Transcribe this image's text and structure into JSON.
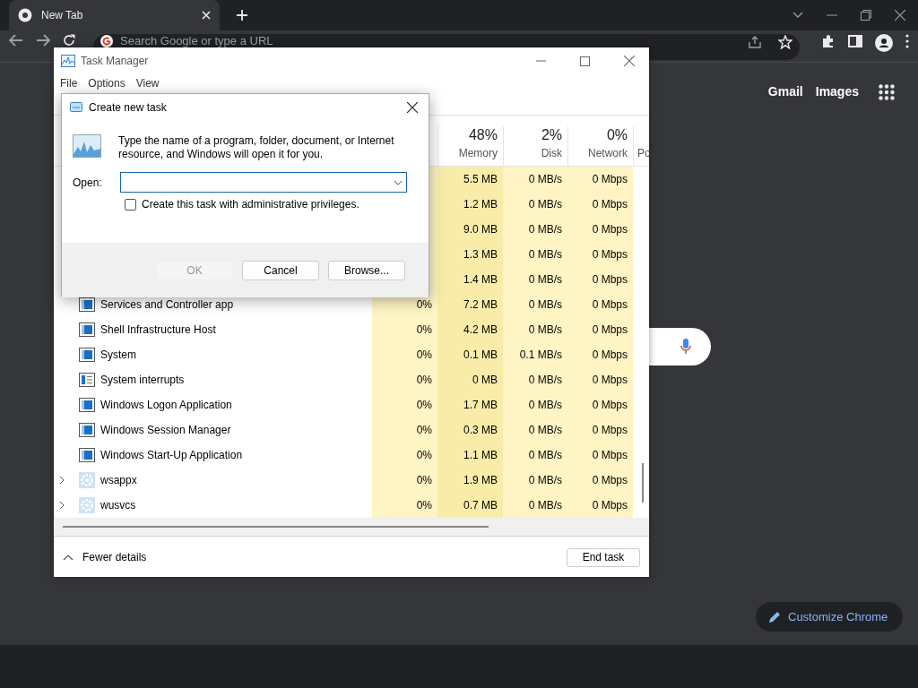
{
  "browser": {
    "tabs": [
      {
        "label": "New Tab",
        "selected": true
      }
    ],
    "omnibox": {
      "placeholder": "Search Google or type a URL"
    },
    "header_links": [
      "Gmail",
      "Images"
    ],
    "customize_button": "Customize Chrome"
  },
  "task_manager": {
    "title": "Task Manager",
    "menu": [
      "File",
      "Options",
      "View"
    ],
    "columns": [
      {
        "percent": "48%",
        "label": "Memory"
      },
      {
        "percent": "2%",
        "label": "Disk"
      },
      {
        "percent": "0%",
        "label": "Network"
      },
      {
        "label": "Po"
      }
    ],
    "rows": [
      {
        "memory": "5.5 MB",
        "disk": "0 MB/s",
        "network": "0 Mbps"
      },
      {
        "memory": "1.2 MB",
        "disk": "0 MB/s",
        "network": "0 Mbps"
      },
      {
        "memory": "9.0 MB",
        "disk": "0 MB/s",
        "network": "0 Mbps"
      },
      {
        "memory": "1.3 MB",
        "disk": "0 MB/s",
        "network": "0 Mbps"
      },
      {
        "memory": "1.4 MB",
        "disk": "0 MB/s",
        "network": "0 Mbps"
      },
      {
        "kind": "process",
        "name": "Services and Controller app",
        "cpu": "0%",
        "memory": "7.2 MB",
        "disk": "0 MB/s",
        "network": "0 Mbps"
      },
      {
        "kind": "process",
        "name": "Shell Infrastructure Host",
        "cpu": "0%",
        "memory": "4.2 MB",
        "disk": "0 MB/s",
        "network": "0 Mbps"
      },
      {
        "kind": "process",
        "name": "System",
        "cpu": "0%",
        "memory": "0.1 MB",
        "disk": "0.1 MB/s",
        "network": "0 Mbps"
      },
      {
        "kind": "interrupts",
        "name": "System interrupts",
        "cpu": "0%",
        "memory": "0 MB",
        "disk": "0 MB/s",
        "network": "0 Mbps"
      },
      {
        "kind": "process",
        "name": "Windows Logon Application",
        "cpu": "0%",
        "memory": "1.7 MB",
        "disk": "0 MB/s",
        "network": "0 Mbps"
      },
      {
        "kind": "process",
        "name": "Windows Session Manager",
        "cpu": "0%",
        "memory": "0.3 MB",
        "disk": "0 MB/s",
        "network": "0 Mbps"
      },
      {
        "kind": "process",
        "name": "Windows Start-Up Application",
        "cpu": "0%",
        "memory": "1.1 MB",
        "disk": "0 MB/s",
        "network": "0 Mbps"
      },
      {
        "kind": "service",
        "name": "wsappx",
        "expanded": false,
        "cpu": "0%",
        "memory": "1.9 MB",
        "disk": "0 MB/s",
        "network": "0 Mbps"
      },
      {
        "kind": "service",
        "name": "wusvcs",
        "expanded": false,
        "cpu": "0%",
        "memory": "0.7 MB",
        "disk": "0 MB/s",
        "network": "0 Mbps"
      }
    ],
    "footer": {
      "toggle": "Fewer details",
      "end_task": "End task"
    }
  },
  "dialog": {
    "title": "Create new task",
    "message": "Type the name of a program, folder, document, or Internet resource, and Windows will open it for you.",
    "open_label": "Open:",
    "admin": {
      "label": "Create this task with administrative privileges.",
      "checked": false
    },
    "buttons": [
      {
        "label": "OK",
        "disabled": true
      },
      {
        "label": "Cancel",
        "disabled": false
      },
      {
        "label": "Browse...",
        "disabled": false
      }
    ]
  }
}
